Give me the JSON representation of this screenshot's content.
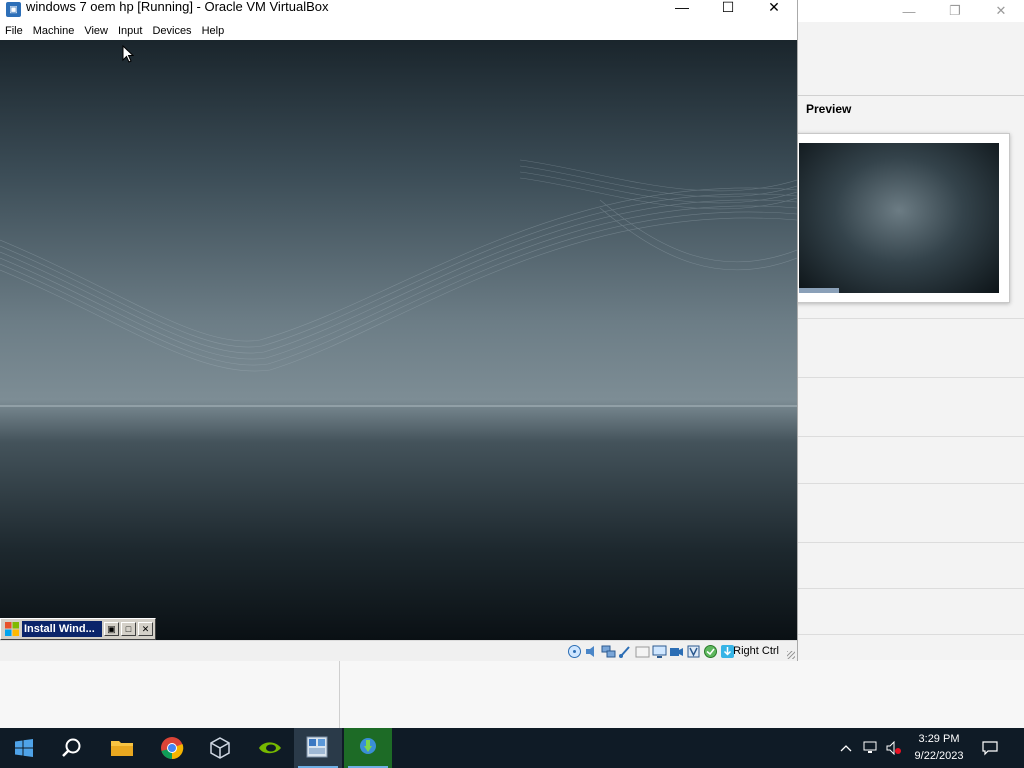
{
  "vm_window": {
    "title": "windows 7 oem hp [Running] - Oracle VM VirtualBox",
    "controls": {
      "minimize": "—",
      "maximize": "☐",
      "close": "✕"
    },
    "menu": [
      "File",
      "Machine",
      "View",
      "Input",
      "Devices",
      "Help"
    ]
  },
  "manager": {
    "controls": {
      "minimize": "—",
      "restore": "❐",
      "close": "✕"
    },
    "preview_label": "Preview"
  },
  "guest": {
    "taskbar_button_label": "Install Wind..."
  },
  "statusbar": {
    "indicator_icons": [
      "optical-disk-icon",
      "audio-icon",
      "network-icon",
      "usb-icon",
      "shared-folders-icon",
      "display-icon",
      "video-capture-icon",
      "recording-icon",
      "virtualization-icon",
      "mouse-integration-icon",
      "keyboard-icon"
    ],
    "host_key": "Right Ctrl"
  },
  "taskbar": {
    "apps": [
      "windows-start-icon",
      "search-icon",
      "file-explorer-icon",
      "chrome-icon",
      "virtualbox-icon",
      "nvidia-icon",
      "vista-installer-icon",
      "internet-download-manager-icon"
    ],
    "active_app": "vista-installer-icon",
    "clock_time": "3:29 PM",
    "clock_date": "9/22/2023"
  },
  "colors": {
    "taskbar_bg": "#0f1b26",
    "guest_selection": "#0a246a",
    "accent": "#6fb0e6"
  }
}
